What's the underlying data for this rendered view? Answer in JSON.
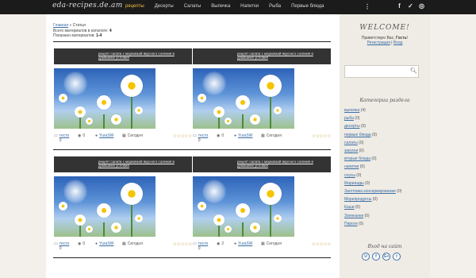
{
  "header": {
    "logo": "eda-recipes.de.am",
    "nav": [
      {
        "label": "рецепты",
        "active": true
      },
      {
        "label": "Десерты",
        "active": false
      },
      {
        "label": "Салаты",
        "active": false
      },
      {
        "label": "Выпечка",
        "active": false
      },
      {
        "label": "Напитки",
        "active": false
      },
      {
        "label": "Рыба",
        "active": false
      },
      {
        "label": "Первые блюда",
        "active": false
      }
    ],
    "more": "⋮",
    "social": [
      "f",
      "vk",
      "ig"
    ]
  },
  "breadcrumb": {
    "home": "Главная",
    "sep": " » ",
    "current": "Статьи"
  },
  "catalog": {
    "total_label": "Всего материалов в каталоге: ",
    "total": "4",
    "shown_label": "Показано материалов: ",
    "shown": "1-4"
  },
  "cards": [
    {
      "title": "рецепт салата с морковкой вкусного соления в домашних условия",
      "category": "тесто",
      "category_count": "0",
      "comments": "0",
      "author": "YuraSW",
      "date": "Сегодня"
    },
    {
      "title": "рецепт салата с морковкой вкусного соления в домашних условия",
      "category": "тесто",
      "category_count": "0",
      "comments": "0",
      "author": "YuraSW",
      "date": "Сегодня"
    },
    {
      "title": "рецепт салата с морковкой вкусного соления в домашних условия",
      "category": "тесто",
      "category_count": "0",
      "comments": "0",
      "author": "YuraSW",
      "date": "Сегодня"
    },
    {
      "title": "рецепт салата с морковкой вкусного соления в домашних условия",
      "category": "тесто",
      "category_count": "0",
      "comments": "2",
      "author": "YuraSW",
      "date": "Сегодня"
    }
  ],
  "sidebar": {
    "welcome": "WELCOME!",
    "greeting": "Приветствую Вас, ",
    "guest": "Гость",
    "greeting_end": "!",
    "register": "Регистрация",
    "divider": " | ",
    "login": "Вход",
    "search_placeholder": "",
    "categories_title": "Категории раздела",
    "categories": [
      {
        "name": "выпечка",
        "count": "(4)"
      },
      {
        "name": "рыба",
        "count": "(0)"
      },
      {
        "name": "десерты",
        "count": "(0)"
      },
      {
        "name": "первые блюда",
        "count": "(0)"
      },
      {
        "name": "салаты",
        "count": "(0)"
      },
      {
        "name": "закуски",
        "count": "(0)"
      },
      {
        "name": "вторые блюда",
        "count": "(0)"
      },
      {
        "name": "напитки",
        "count": "(0)"
      },
      {
        "name": "соусы",
        "count": "(0)"
      },
      {
        "name": "Маринады",
        "count": "(0)"
      },
      {
        "name": "Заготовка консервирование",
        "count": "(0)"
      },
      {
        "name": "Морепродукты",
        "count": "(0)"
      },
      {
        "name": "Каши",
        "count": "(0)"
      },
      {
        "name": "Запеканки",
        "count": "(0)"
      },
      {
        "name": "Пироги",
        "count": "(0)"
      }
    ],
    "follow_title": "Вход на сайт",
    "follow_icons": [
      "U",
      "f",
      "G+",
      "t"
    ]
  }
}
